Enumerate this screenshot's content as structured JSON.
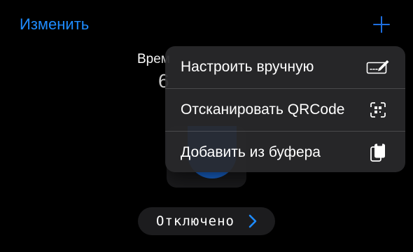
{
  "header": {
    "edit_label": "Изменить",
    "add_icon": "plus-icon",
    "accent_color": "#1e8cff"
  },
  "background": {
    "time_label_partial": "Врем",
    "time_value_partial": "6"
  },
  "status": {
    "label": "Отключено",
    "chevron_icon": "chevron-right-icon"
  },
  "menu": {
    "items": [
      {
        "label": "Настроить вручную",
        "icon": "manual-edit-icon"
      },
      {
        "label": "Отсканировать QRCode",
        "icon": "qr-scan-icon"
      },
      {
        "label": "Добавить из буфера",
        "icon": "clipboard-icon"
      }
    ]
  }
}
